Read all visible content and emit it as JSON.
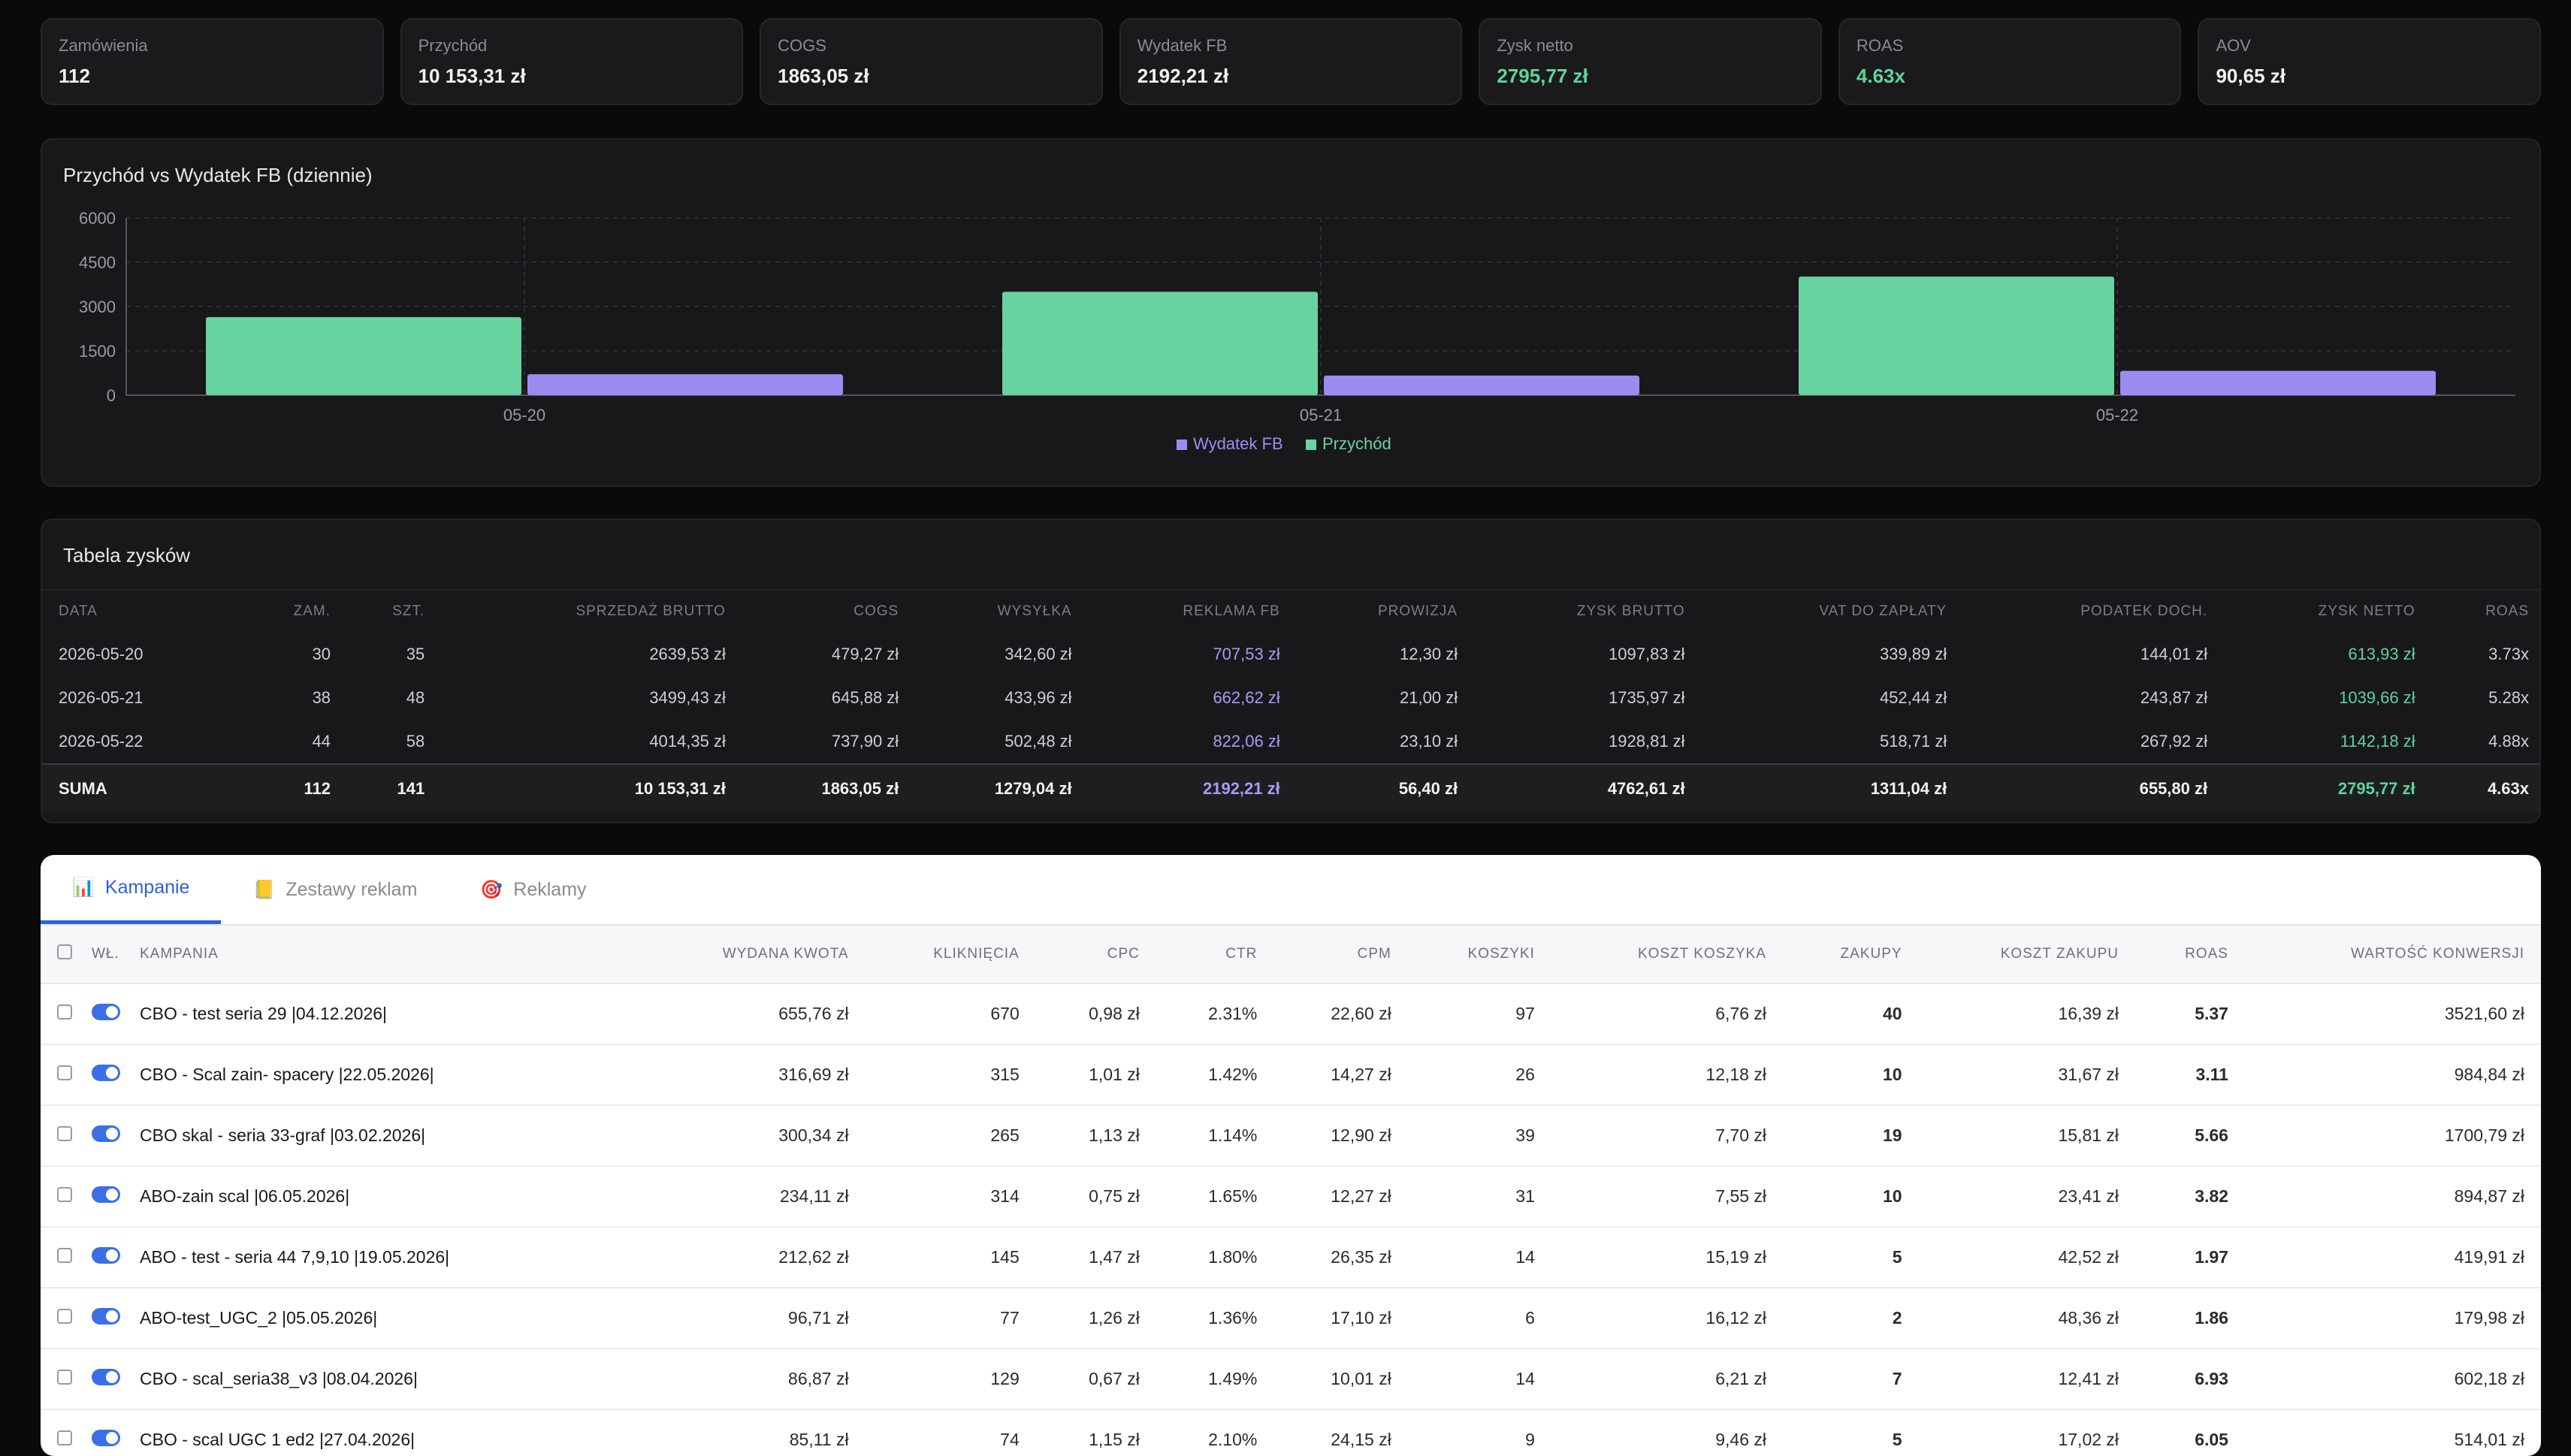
{
  "kpis": [
    {
      "label": "Zamówienia",
      "value": "112",
      "accent": "default"
    },
    {
      "label": "Przychód",
      "value": "10 153,31 zł",
      "accent": "default"
    },
    {
      "label": "COGS",
      "value": "1863,05 zł",
      "accent": "default"
    },
    {
      "label": "Wydatek FB",
      "value": "2192,21 zł",
      "accent": "default"
    },
    {
      "label": "Zysk netto",
      "value": "2795,77 zł",
      "accent": "green"
    },
    {
      "label": "ROAS",
      "value": "4.63x",
      "accent": "green"
    },
    {
      "label": "AOV",
      "value": "90,65 zł",
      "accent": "default"
    }
  ],
  "chart_data": {
    "type": "bar",
    "title": "Przychód vs Wydatek FB (dziennie)",
    "categories": [
      "05-20",
      "05-21",
      "05-22"
    ],
    "series": [
      {
        "name": "Przychód",
        "values": [
          2639.53,
          3499.43,
          4014.35
        ],
        "color": "#68d3a0"
      },
      {
        "name": "Wydatek FB",
        "values": [
          707.53,
          662.62,
          822.06
        ],
        "color": "#9b8cf0"
      }
    ],
    "ylim": [
      0,
      6000
    ],
    "yticks": [
      "0",
      "1500",
      "3000",
      "4500",
      "6000"
    ],
    "legend": [
      "Wydatek FB",
      "Przychód"
    ],
    "legend_position": "bottom",
    "grid": true
  },
  "profit_table": {
    "title": "Tabela zysków",
    "headers": [
      "Data",
      "Zam.",
      "Szt.",
      "Sprzedaż brutto",
      "COGS",
      "Wysyłka",
      "Reklama FB",
      "Prowizja",
      "Zysk brutto",
      "VAT do zapłaty",
      "Podatek doch.",
      "Zysk netto",
      "ROAS"
    ],
    "rows": [
      [
        "2026-05-20",
        "30",
        "35",
        "2639,53 zł",
        "479,27 zł",
        "342,60 zł",
        "707,53 zł",
        "12,30 zł",
        "1097,83 zł",
        "339,89 zł",
        "144,01 zł",
        "613,93 zł",
        "3.73x"
      ],
      [
        "2026-05-21",
        "38",
        "48",
        "3499,43 zł",
        "645,88 zł",
        "433,96 zł",
        "662,62 zł",
        "21,00 zł",
        "1735,97 zł",
        "452,44 zł",
        "243,87 zł",
        "1039,66 zł",
        "5.28x"
      ],
      [
        "2026-05-22",
        "44",
        "58",
        "4014,35 zł",
        "737,90 zł",
        "502,48 zł",
        "822,06 zł",
        "23,10 zł",
        "1928,81 zł",
        "518,71 zł",
        "267,92 zł",
        "1142,18 zł",
        "4.88x"
      ]
    ],
    "sum": [
      "SUMA",
      "112",
      "141",
      "10 153,31 zł",
      "1863,05 zł",
      "1279,04 zł",
      "2192,21 zł",
      "56,40 zł",
      "4762,61 zł",
      "1311,04 zł",
      "655,80 zł",
      "2795,77 zł",
      "4.63x"
    ]
  },
  "tabs": [
    {
      "label": "Kampanie",
      "icon": "bar-chart-icon",
      "glyph": "📊",
      "active": true
    },
    {
      "label": "Zestawy reklam",
      "icon": "ledger-icon",
      "glyph": "📒",
      "active": false
    },
    {
      "label": "Reklamy",
      "icon": "target-icon",
      "glyph": "🎯",
      "active": false
    }
  ],
  "campaign_table": {
    "headers": [
      "Wł.",
      "Kampania",
      "Wydana kwota",
      "Kliknięcia",
      "CPC",
      "CTR",
      "CPM",
      "Koszyki",
      "Koszt koszyka",
      "Zakupy",
      "Koszt zakupu",
      "ROAS",
      "Wartość konwersji"
    ],
    "rows": [
      {
        "name": "CBO - test seria 29 |04.12.2026|",
        "spend": "655,76 zł",
        "clicks": "670",
        "cpc": "0,98 zł",
        "ctr": "2.31%",
        "cpm": "22,60 zł",
        "carts": "97",
        "cart_cost": "6,76 zł",
        "purchases": "40",
        "purchase_cost": "16,39 zł",
        "roas": "5.37",
        "roas_good": true,
        "conv": "3521,60 zł"
      },
      {
        "name": "CBO - Scal zain- spacery |22.05.2026|",
        "spend": "316,69 zł",
        "clicks": "315",
        "cpc": "1,01 zł",
        "ctr": "1.42%",
        "cpm": "14,27 zł",
        "carts": "26",
        "cart_cost": "12,18 zł",
        "purchases": "10",
        "purchase_cost": "31,67 zł",
        "roas": "3.11",
        "roas_good": true,
        "conv": "984,84 zł"
      },
      {
        "name": "CBO skal - seria 33-graf |03.02.2026|",
        "spend": "300,34 zł",
        "clicks": "265",
        "cpc": "1,13 zł",
        "ctr": "1.14%",
        "cpm": "12,90 zł",
        "carts": "39",
        "cart_cost": "7,70 zł",
        "purchases": "19",
        "purchase_cost": "15,81 zł",
        "roas": "5.66",
        "roas_good": true,
        "conv": "1700,79 zł"
      },
      {
        "name": "ABO-zain scal |06.05.2026|",
        "spend": "234,11 zł",
        "clicks": "314",
        "cpc": "0,75 zł",
        "ctr": "1.65%",
        "cpm": "12,27 zł",
        "carts": "31",
        "cart_cost": "7,55 zł",
        "purchases": "10",
        "purchase_cost": "23,41 zł",
        "roas": "3.82",
        "roas_good": true,
        "conv": "894,87 zł"
      },
      {
        "name": "ABO - test - seria 44 7,9,10 |19.05.2026|",
        "spend": "212,62 zł",
        "clicks": "145",
        "cpc": "1,47 zł",
        "ctr": "1.80%",
        "cpm": "26,35 zł",
        "carts": "14",
        "cart_cost": "15,19 zł",
        "purchases": "5",
        "purchase_cost": "42,52 zł",
        "roas": "1.97",
        "roas_good": false,
        "conv": "419,91 zł"
      },
      {
        "name": "ABO-test_UGC_2 |05.05.2026|",
        "spend": "96,71 zł",
        "clicks": "77",
        "cpc": "1,26 zł",
        "ctr": "1.36%",
        "cpm": "17,10 zł",
        "carts": "6",
        "cart_cost": "16,12 zł",
        "purchases": "2",
        "purchase_cost": "48,36 zł",
        "roas": "1.86",
        "roas_good": false,
        "conv": "179,98 zł"
      },
      {
        "name": "CBO - scal_seria38_v3 |08.04.2026|",
        "spend": "86,87 zł",
        "clicks": "129",
        "cpc": "0,67 zł",
        "ctr": "1.49%",
        "cpm": "10,01 zł",
        "carts": "14",
        "cart_cost": "6,21 zł",
        "purchases": "7",
        "purchase_cost": "12,41 zł",
        "roas": "6.93",
        "roas_good": true,
        "conv": "602,18 zł"
      },
      {
        "name": "CBO - scal UGC 1 ed2 |27.04.2026|",
        "spend": "85,11 zł",
        "clicks": "74",
        "cpc": "1,15 zł",
        "ctr": "2.10%",
        "cpm": "24,15 zł",
        "carts": "9",
        "cart_cost": "9,46 zł",
        "purchases": "5",
        "purchase_cost": "17,02 zł",
        "roas": "6.05",
        "roas_good": true,
        "conv": "514,01 zł"
      }
    ]
  }
}
